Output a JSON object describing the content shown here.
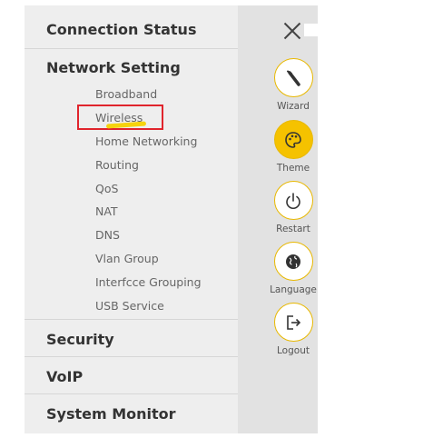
{
  "menu": {
    "sections": [
      {
        "label": "Connection Status"
      },
      {
        "label": "Network Setting"
      },
      {
        "label": "Security"
      },
      {
        "label": "VoIP"
      },
      {
        "label": "System Monitor"
      }
    ],
    "network_items": [
      {
        "label": "Broadband"
      },
      {
        "label": "Wireless"
      },
      {
        "label": "Home Networking"
      },
      {
        "label": "Routing"
      },
      {
        "label": "QoS"
      },
      {
        "label": "NAT"
      },
      {
        "label": "DNS"
      },
      {
        "label": "Vlan Group"
      },
      {
        "label": "Interfcce Grouping"
      },
      {
        "label": "USB Service"
      }
    ],
    "highlighted_item": "Wireless"
  },
  "toolbar": {
    "tools": [
      {
        "label": "Wizard",
        "icon": "wand-icon"
      },
      {
        "label": "Theme",
        "icon": "palette-icon"
      },
      {
        "label": "Restart",
        "icon": "power-icon"
      },
      {
        "label": "Language",
        "icon": "globe-icon"
      },
      {
        "label": "Logout",
        "icon": "logout-icon"
      }
    ]
  },
  "colors": {
    "accent": "#f5c200",
    "highlight_box": "#e0242c",
    "marker": "#f5d100"
  }
}
